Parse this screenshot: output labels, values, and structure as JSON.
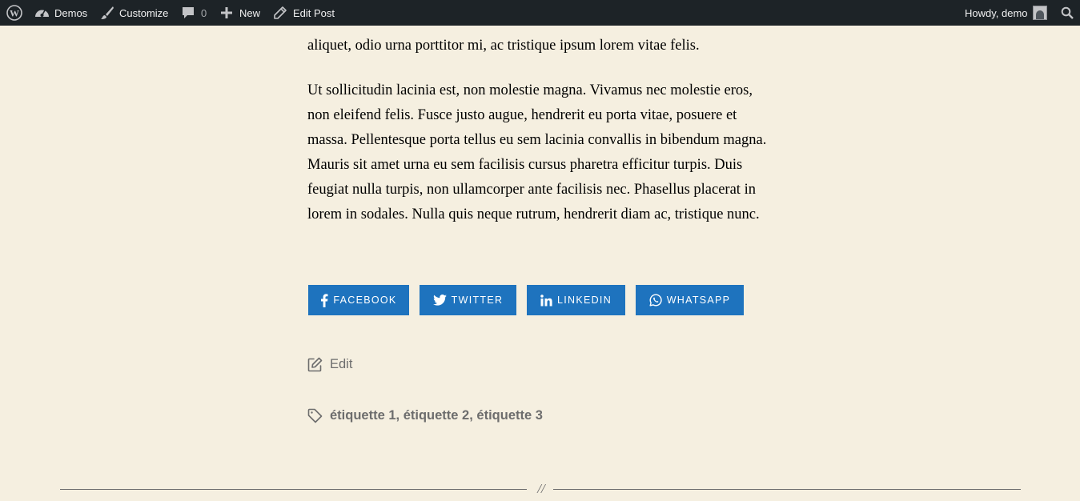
{
  "adminbar": {
    "site_name": "Demos",
    "customize": "Customize",
    "comments_count": "0",
    "new_label": "New",
    "edit_post": "Edit Post",
    "greeting": "Howdy, demo",
    "icons": [
      "wordpress-icon",
      "dashboard-icon",
      "brush-icon",
      "comment-icon",
      "plus-icon",
      "pencil-icon",
      "avatar",
      "search-icon"
    ]
  },
  "post": {
    "paragraph_partial": "aliquet, odio urna porttitor mi, ac tristique ipsum lorem vitae felis.",
    "paragraph_2": "Ut sollicitudin lacinia est, non molestie magna. Vivamus nec molestie eros, non eleifend felis. Fusce justo augue, hendrerit eu porta vitae, posuere et massa. Pellentesque porta tellus eu sem lacinia convallis in bibendum magna. Mauris sit amet urna eu sem facilisis cursus pharetra efficitur turpis. Duis feugiat nulla turpis, non ullamcorper ante facilisis nec. Phasellus placerat in lorem in sodales. Nulla quis neque rutrum, hendrerit diam ac, tristique nunc."
  },
  "share": {
    "facebook": "FACEBOOK",
    "twitter": "TWITTER",
    "linkedin": "LINKEDIN",
    "whatsapp": "WHATSAPP",
    "color": "#1e73be"
  },
  "meta": {
    "edit": "Edit",
    "tags": [
      "étiquette 1",
      "étiquette 2",
      "étiquette 3"
    ],
    "tag_separator": ", "
  },
  "separator": {
    "mark": "//"
  },
  "colors": {
    "background": "#f5efe0",
    "adminbar": "#1d2327",
    "meta_text": "#6d6d6d"
  }
}
